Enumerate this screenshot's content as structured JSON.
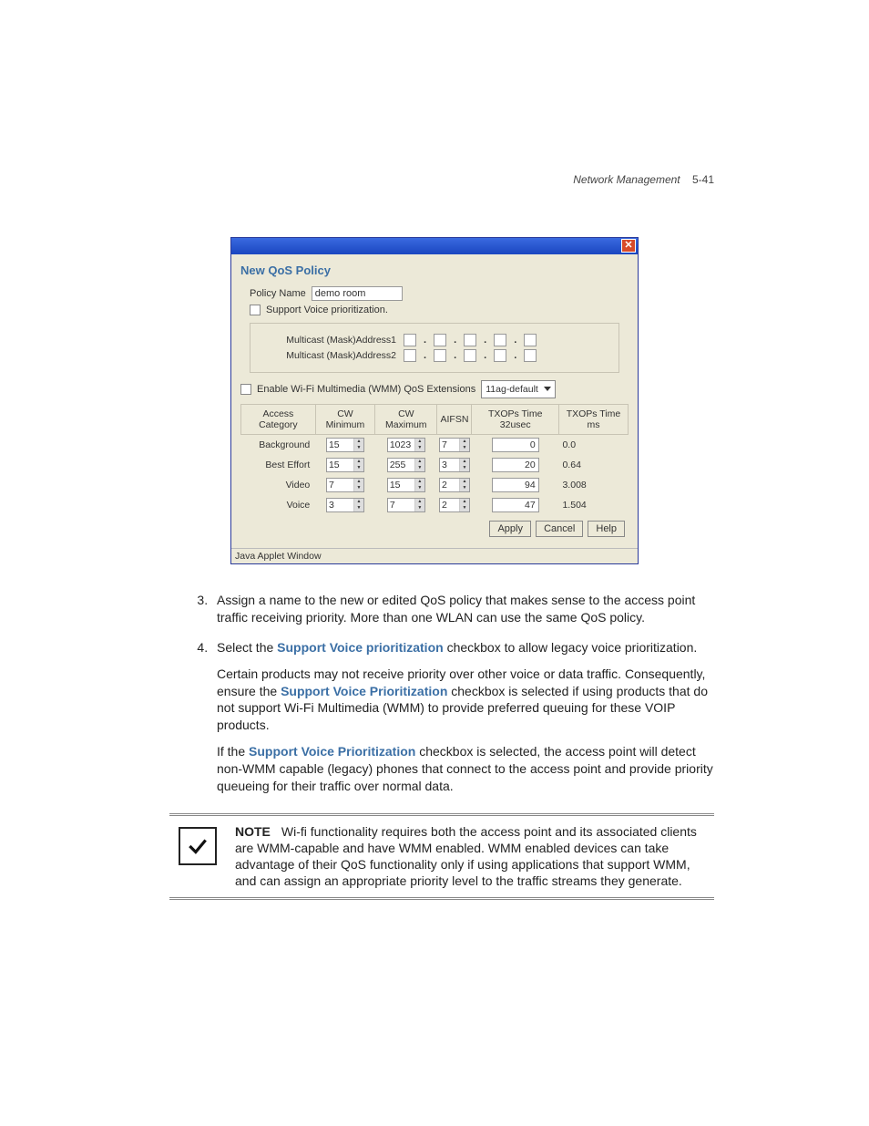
{
  "header": {
    "section": "Network Management",
    "page": "5-41"
  },
  "dialog": {
    "title": "New QoS Policy",
    "policy_name_label": "Policy Name",
    "policy_name_value": "demo room",
    "support_voice_label": "Support Voice prioritization.",
    "multicast1_label": "Multicast (Mask)Address1",
    "multicast2_label": "Multicast (Mask)Address2",
    "enable_wmm_label": "Enable Wi-Fi Multimedia (WMM) QoS Extensions",
    "wmm_profile": "11ag-default",
    "table_headers": {
      "access": "Access Category",
      "cwmin": "CW Minimum",
      "cwmax": "CW Maximum",
      "aifsn": "AIFSN",
      "txops32": "TXOPs Time 32usec",
      "txopsms": "TXOPs Time ms"
    },
    "rows": [
      {
        "cat": "Background",
        "cwmin": "15",
        "cwmax": "1023",
        "aifsn": "7",
        "tx32": "0",
        "txms": "0.0"
      },
      {
        "cat": "Best Effort",
        "cwmin": "15",
        "cwmax": "255",
        "aifsn": "3",
        "tx32": "20",
        "txms": "0.64"
      },
      {
        "cat": "Video",
        "cwmin": "7",
        "cwmax": "15",
        "aifsn": "2",
        "tx32": "94",
        "txms": "3.008"
      },
      {
        "cat": "Voice",
        "cwmin": "3",
        "cwmax": "7",
        "aifsn": "2",
        "tx32": "47",
        "txms": "1.504"
      }
    ],
    "buttons": {
      "apply": "Apply",
      "cancel": "Cancel",
      "help": "Help"
    },
    "status": "Java Applet Window"
  },
  "instructions": {
    "item3": "Assign a name to the new or edited QoS policy that makes sense to the access point traffic receiving priority. More than one WLAN can use the same QoS policy.",
    "item4_pre": "Select the ",
    "item4_link": "Support Voice prioritization",
    "item4_post": " checkbox to allow legacy voice prioritization.",
    "item4_p2_pre": "Certain products may not receive priority over other voice or data traffic. Consequently, ensure the ",
    "item4_p2_link": "Support Voice Prioritization",
    "item4_p2_post": " checkbox is selected if using products that do not support Wi-Fi Multimedia (WMM) to provide preferred queuing for these VOIP products.",
    "item4_p3_pre": "If the ",
    "item4_p3_link": "Support Voice Prioritization",
    "item4_p3_post": " checkbox is selected, the access point will detect non-WMM capable (legacy) phones that connect to the access point and provide priority queueing for their traffic over normal data."
  },
  "note": {
    "label": "NOTE",
    "text": "Wi-fi functionality requires both the access point and its associated clients are WMM-capable and have WMM enabled. WMM enabled devices can take advantage of their QoS functionality only if using applications that support WMM, and can assign an appropriate priority level to the traffic streams they generate."
  }
}
